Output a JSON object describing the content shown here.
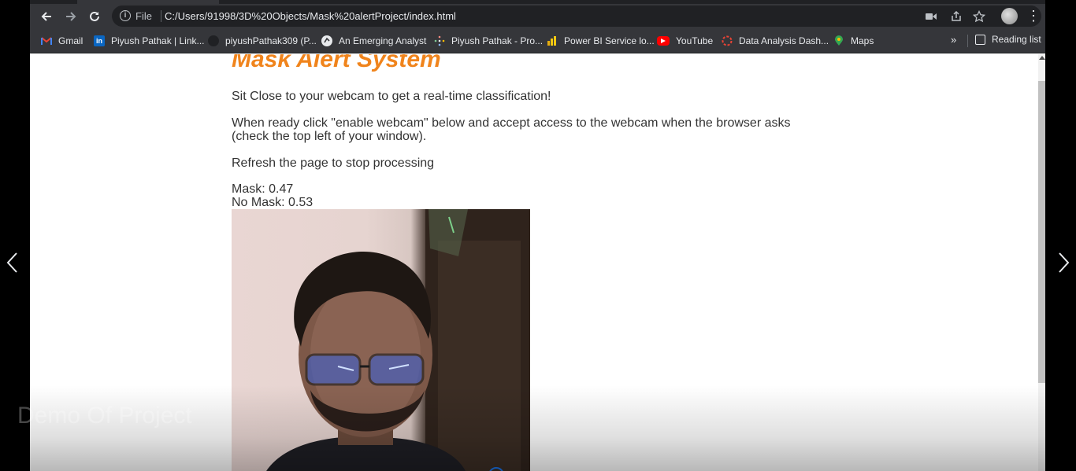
{
  "browser": {
    "url_scheme_label": "File",
    "url": "C:/Users/91998/3D%20Objects/Mask%20alertProject/index.html"
  },
  "bookmarks": [
    {
      "label": "Gmail",
      "icon": "gmail-icon",
      "color": "#ea4335"
    },
    {
      "label": "Piyush Pathak | Link...",
      "icon": "linkedin-icon",
      "color": "#0a66c2"
    },
    {
      "label": "piyushPathak309 (P...",
      "icon": "github-icon",
      "color": "#202124"
    },
    {
      "label": "An Emerging Analyst",
      "icon": "globe-icon",
      "color": "#e8eaed"
    },
    {
      "label": "Piyush Pathak - Pro...",
      "icon": "dots-icon",
      "color": "#f28b82"
    },
    {
      "label": "Power BI Service lo...",
      "icon": "power-bi-icon",
      "color": "#f2c811"
    },
    {
      "label": "YouTube",
      "icon": "youtube-icon",
      "color": "#ff0000"
    },
    {
      "label": "Data Analysis Dash...",
      "icon": "dash-icon",
      "color": "#ea4335"
    },
    {
      "label": "Maps",
      "icon": "maps-icon",
      "color": "#34a853"
    }
  ],
  "bookmarks_more": "»",
  "reading_list": "Reading list",
  "page": {
    "title": "Mask Alert System",
    "instruction_1": "Sit Close to your webcam to get a real-time classification!",
    "instruction_2": "When ready click \"enable webcam\" below and accept access to the webcam when the browser asks (check the top left of your window).",
    "instruction_3": "Refresh the page to stop processing",
    "mask_label": "Mask: 0.47",
    "no_mask_label": "No Mask: 0.53"
  },
  "watermark": "Demo Of Project",
  "colors": {
    "title": "#f0841c",
    "chrome_dark": "#35363a",
    "omnibox": "#202124"
  }
}
